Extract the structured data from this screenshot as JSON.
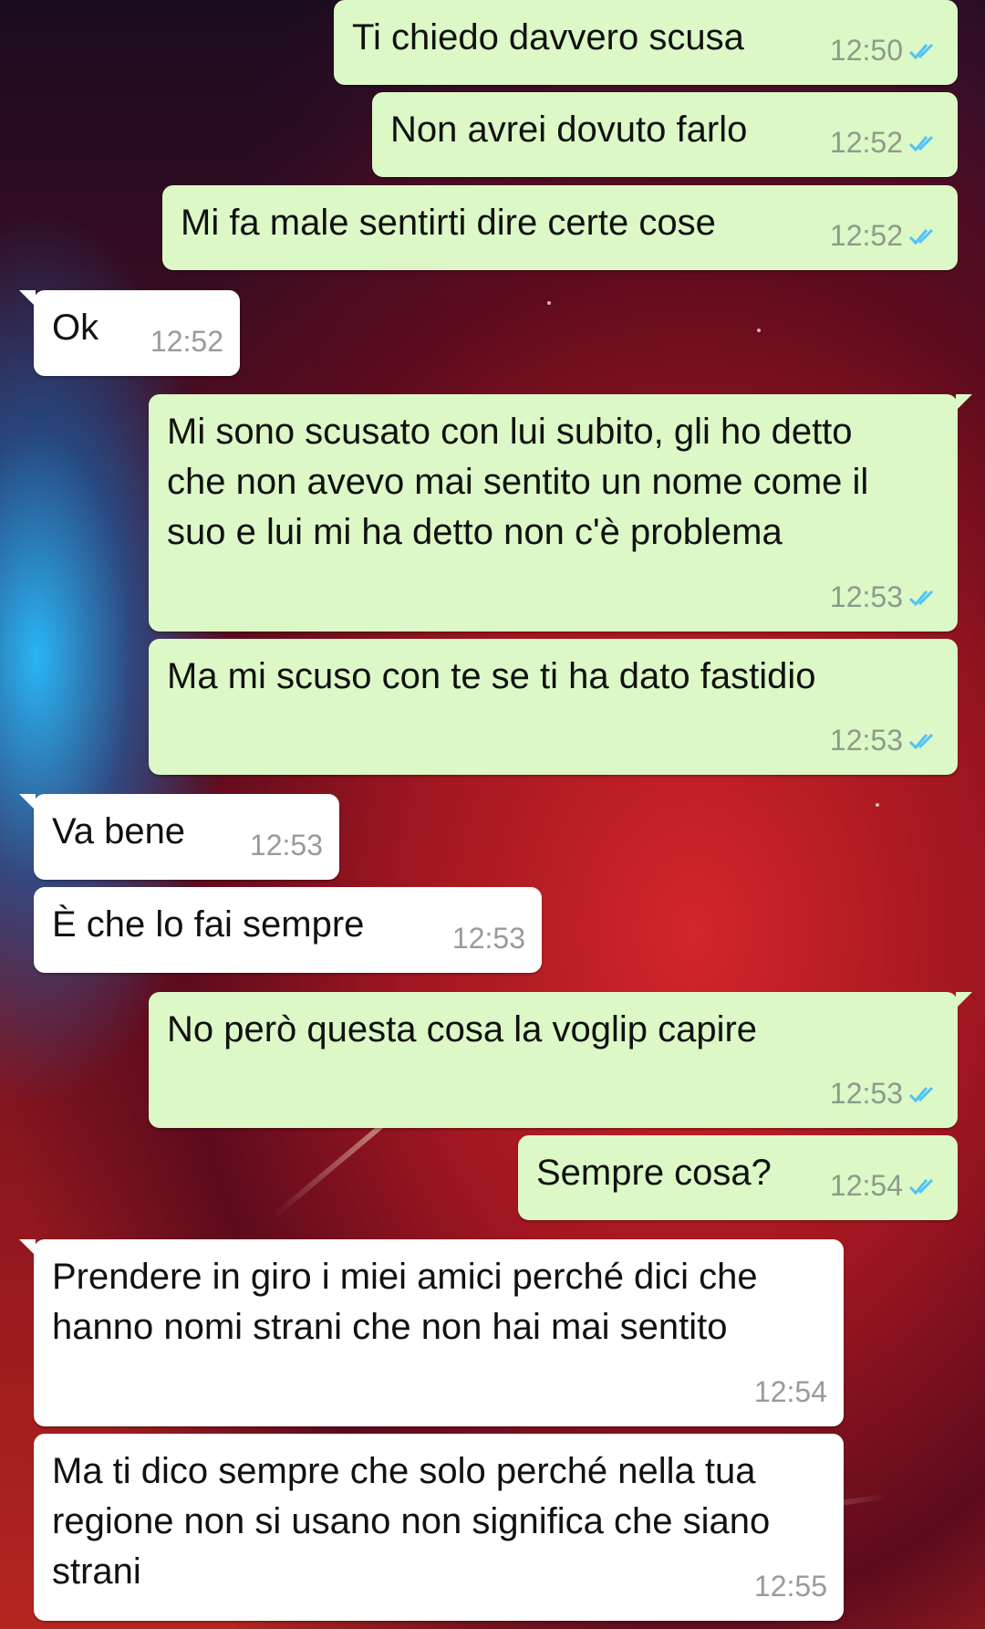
{
  "colors": {
    "outgoing_bubble": "#dcf8c6",
    "incoming_bubble": "#ffffff",
    "read_ticks": "#4fc3f7",
    "timestamp": "#8f9a8a"
  },
  "status_icon": "double-check-read-icon",
  "messages": [
    {
      "direction": "out",
      "text": "Ti chiedo davvero scusa",
      "time": "12:50",
      "read": true
    },
    {
      "direction": "out",
      "text": "Non avrei dovuto farlo",
      "time": "12:52",
      "read": true
    },
    {
      "direction": "out",
      "text": "Mi fa male sentirti dire certe cose",
      "time": "12:52",
      "read": true
    },
    {
      "direction": "in",
      "text": "Ok",
      "time": "12:52"
    },
    {
      "direction": "out",
      "text": "Mi sono scusato con lui subito, gli ho detto che non avevo mai sentito un nome come il suo e lui mi ha detto non c'è problema",
      "time": "12:53",
      "read": true
    },
    {
      "direction": "out",
      "text": "Ma mi scuso con te se ti ha dato fastidio",
      "time": "12:53",
      "read": true
    },
    {
      "direction": "in",
      "text": "Va bene",
      "time": "12:53"
    },
    {
      "direction": "in",
      "text": "È che lo fai sempre",
      "time": "12:53"
    },
    {
      "direction": "out",
      "text": "No però questa cosa la voglip capire",
      "time": "12:53",
      "read": true
    },
    {
      "direction": "out",
      "text": "Sempre cosa?",
      "time": "12:54",
      "read": true
    },
    {
      "direction": "in",
      "text": "Prendere in giro i miei amici perché dici che hanno nomi strani che non hai mai sentito",
      "time": "12:54"
    },
    {
      "direction": "in",
      "text": "Ma ti dico sempre che solo perché nella tua regione non si usano non significa che siano strani",
      "time": "12:55"
    }
  ]
}
